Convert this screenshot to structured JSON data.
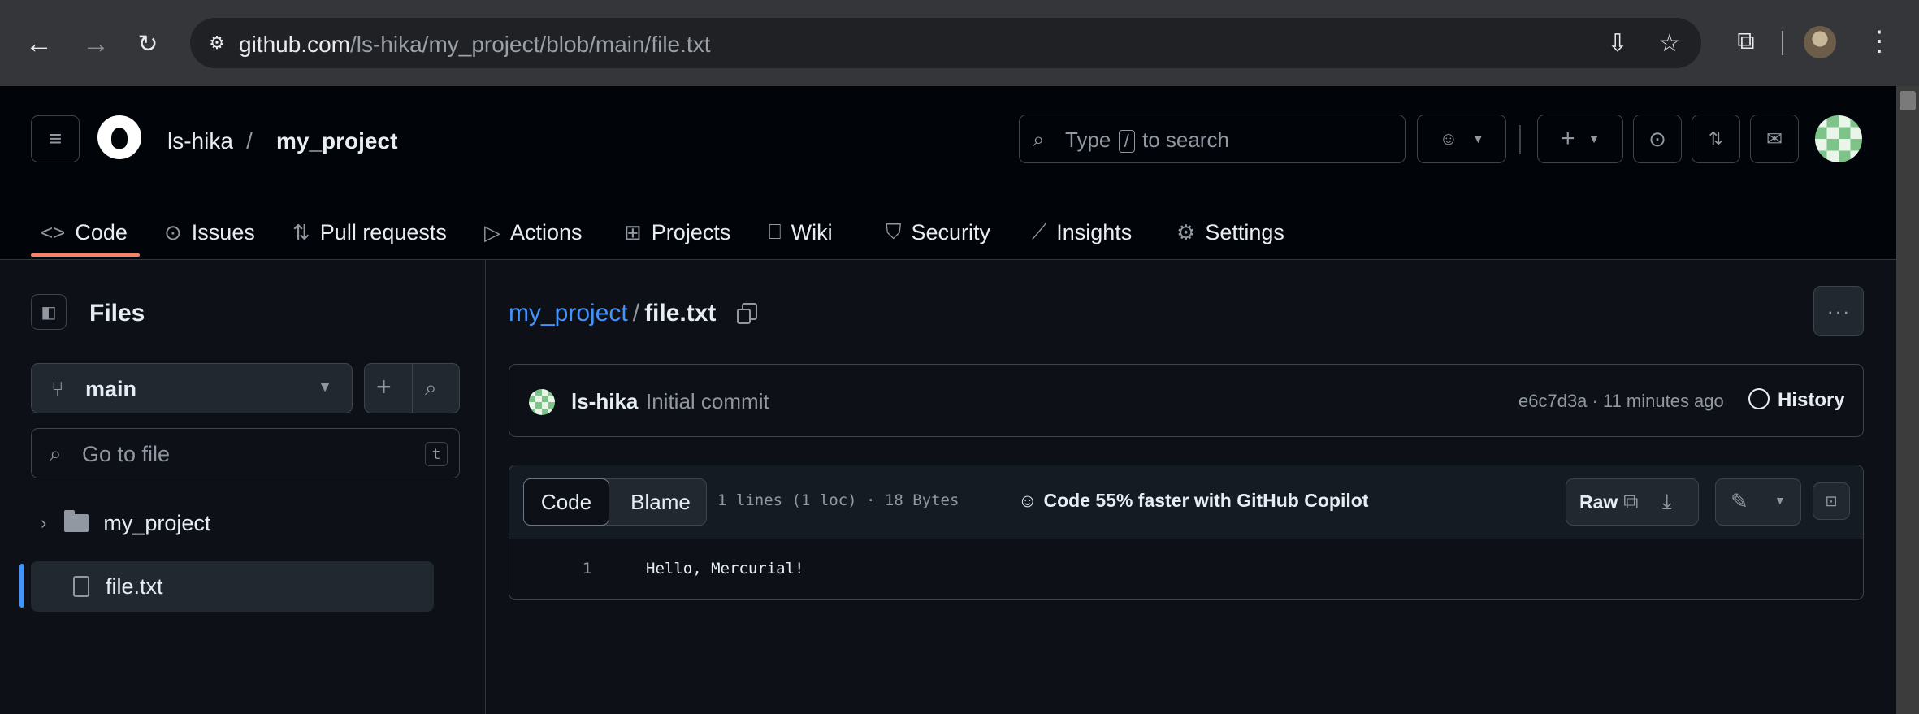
{
  "browser": {
    "url_host": "github.com",
    "url_path": "/ls-hika/my_project/blob/main/file.txt"
  },
  "header": {
    "owner": "ls-hika",
    "separator": "/",
    "repo": "my_project",
    "search_prefix": "Type",
    "search_key": "/",
    "search_suffix": "to search"
  },
  "tabs": [
    {
      "label": "Code",
      "icon": "code-icon"
    },
    {
      "label": "Issues",
      "icon": "issue-icon"
    },
    {
      "label": "Pull requests",
      "icon": "pull-request-icon"
    },
    {
      "label": "Actions",
      "icon": "play-icon"
    },
    {
      "label": "Projects",
      "icon": "table-icon"
    },
    {
      "label": "Wiki",
      "icon": "book-icon"
    },
    {
      "label": "Security",
      "icon": "shield-icon"
    },
    {
      "label": "Insights",
      "icon": "graph-icon"
    },
    {
      "label": "Settings",
      "icon": "gear-icon"
    }
  ],
  "sidebar": {
    "title": "Files",
    "branch": "main",
    "goto_placeholder": "Go to file",
    "goto_shortcut": "t",
    "tree": [
      {
        "label": "my_project",
        "type": "folder"
      },
      {
        "label": "file.txt",
        "type": "file",
        "selected": true
      }
    ]
  },
  "file": {
    "repo": "my_project",
    "separator": "/",
    "name": "file.txt"
  },
  "commit": {
    "author": "ls-hika",
    "message": "Initial commit",
    "meta": "e6c7d3a · 11 minutes ago",
    "history_label": "History"
  },
  "code": {
    "tab_code": "Code",
    "tab_blame": "Blame",
    "loc_info": "1 lines (1 loc) · 18 Bytes",
    "copilot_text": "Code 55% faster with GitHub Copilot",
    "raw_label": "Raw",
    "line_number": "1",
    "line_text": "Hello, Mercurial!"
  }
}
